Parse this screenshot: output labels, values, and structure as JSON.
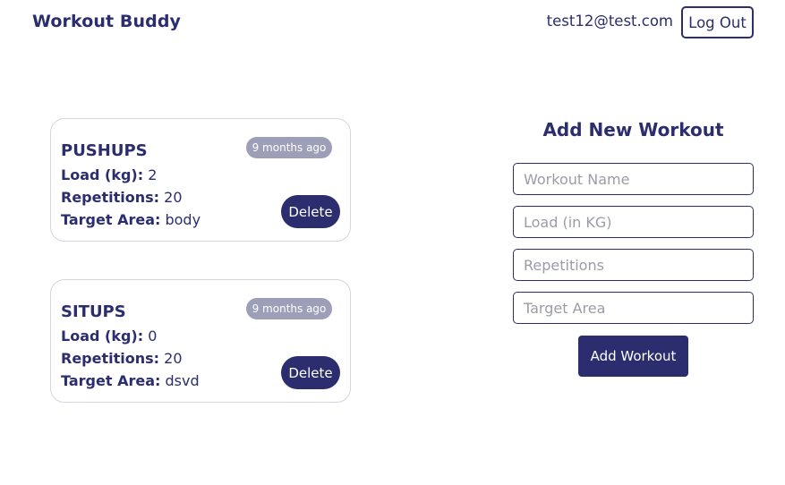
{
  "header": {
    "brand": "Workout Buddy",
    "user_email": "test12@test.com",
    "logout_label": "Log Out"
  },
  "workouts": [
    {
      "title": "PUSHUPS",
      "time_ago": "9 months ago",
      "load_label": "Load (kg):",
      "load_value": "2",
      "reps_label": "Repetitions:",
      "reps_value": "20",
      "target_label": "Target Area:",
      "target_value": "body",
      "delete_label": "Delete"
    },
    {
      "title": "SITUPS",
      "time_ago": "9 months ago",
      "load_label": "Load (kg):",
      "load_value": "0",
      "reps_label": "Repetitions:",
      "reps_value": "20",
      "target_label": "Target Area:",
      "target_value": "dsvd",
      "delete_label": "Delete"
    }
  ],
  "form": {
    "title": "Add New Workout",
    "name_placeholder": "Workout Name",
    "load_placeholder": "Load (in KG)",
    "reps_placeholder": "Repetitions",
    "target_placeholder": "Target Area",
    "submit_label": "Add Workout"
  },
  "colors": {
    "primary": "#2b2d6e",
    "badge": "#9d9fb9",
    "card_border": "#d4d5e0"
  }
}
